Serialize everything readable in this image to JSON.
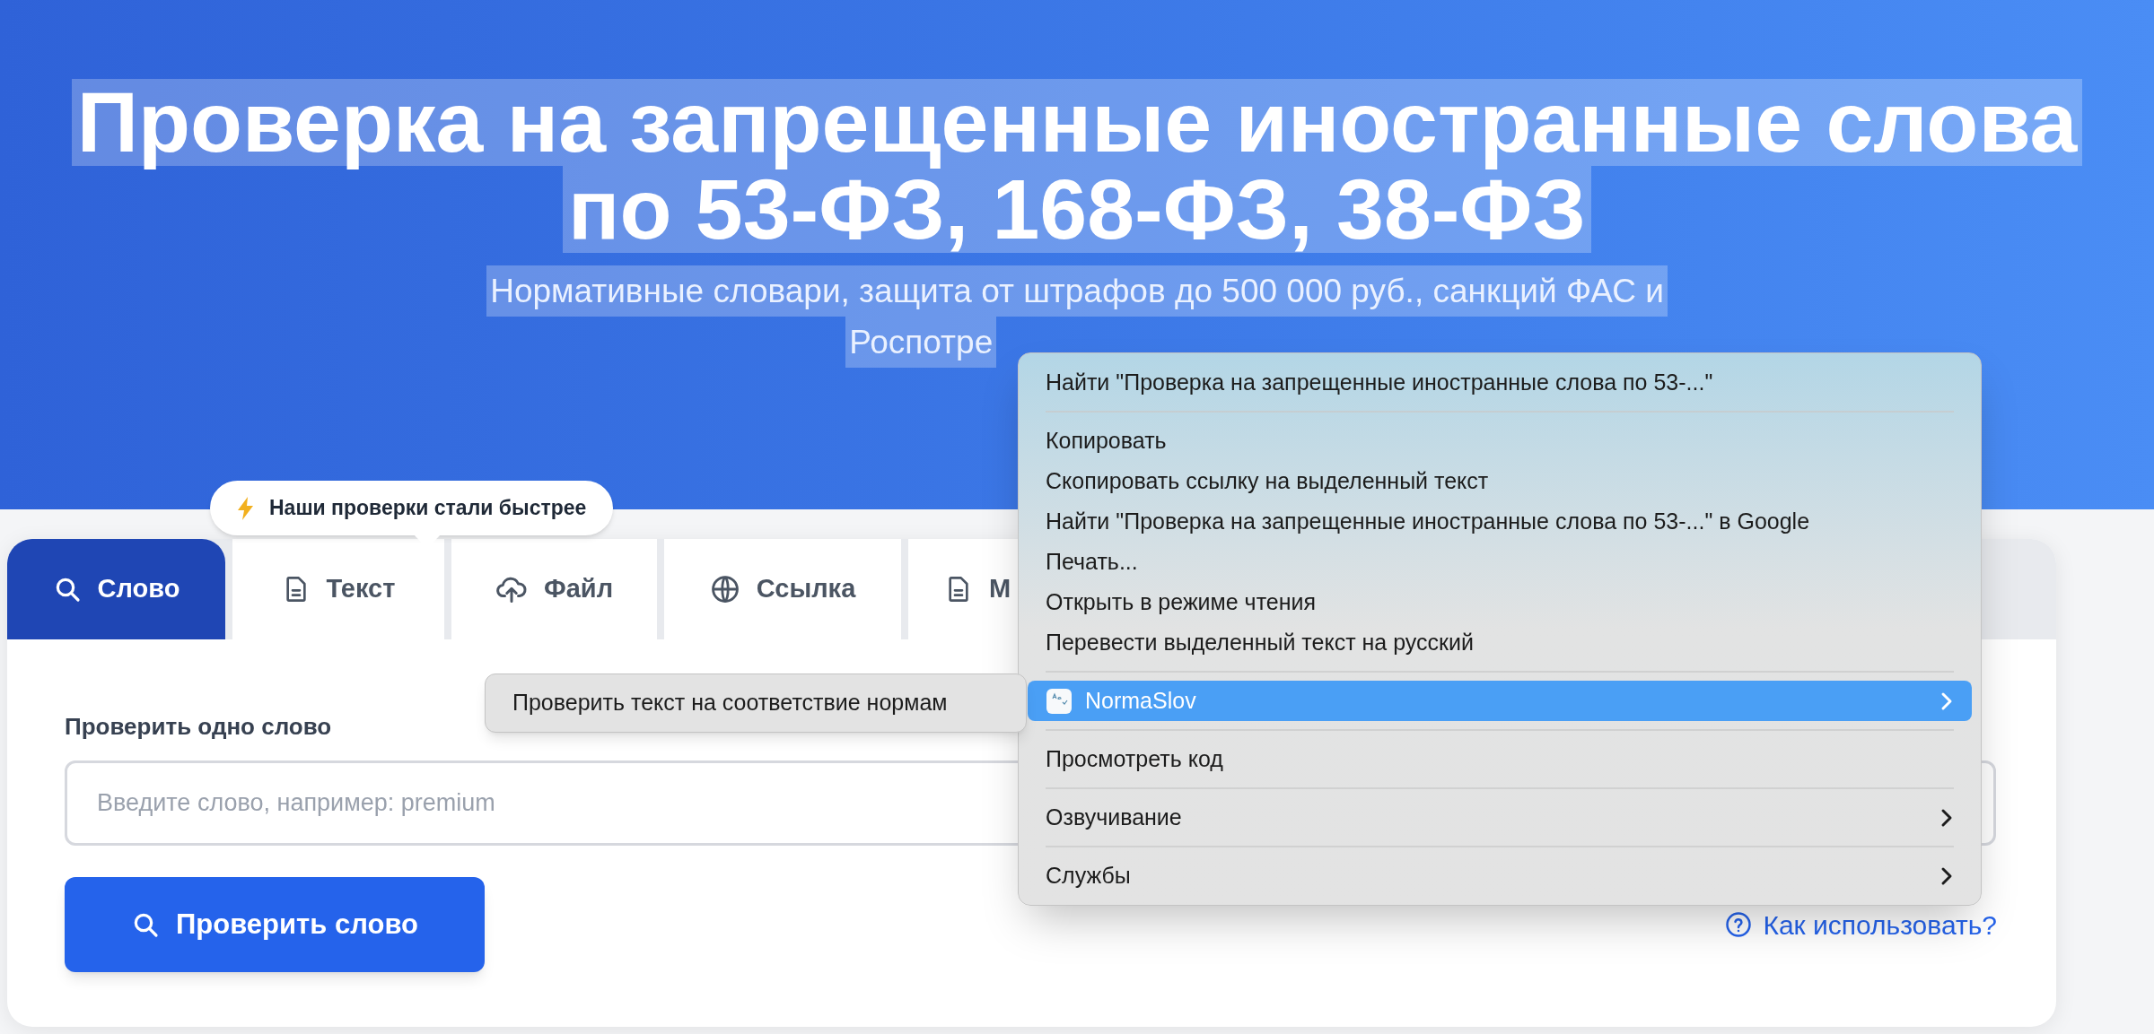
{
  "hero": {
    "selected": true,
    "title_lines": [
      "Проверка на запрещенные иностранные слова",
      "по 53-ФЗ, 168-ФЗ, 38-ФЗ"
    ],
    "subtitle_lines": [
      "Нормативные словари, защита от штрафов до 500 000 руб., санкций ФАС и",
      "Роспотре"
    ]
  },
  "tooltip": {
    "text": "Наши проверки стали быстрее"
  },
  "tabs": [
    {
      "label": "Слово",
      "kind": "search",
      "selected": true
    },
    {
      "label": "Текст",
      "kind": "document",
      "selected": false
    },
    {
      "label": "Файл",
      "kind": "upload",
      "selected": false
    },
    {
      "label": "Ссылка",
      "kind": "globe",
      "selected": false
    },
    {
      "label": "М",
      "kind": "document",
      "selected": false
    }
  ],
  "form": {
    "label": "Проверить одно слово",
    "placeholder": "Введите слово, например: premium",
    "button": "Проверить слово",
    "help_link": "Как использовать?"
  },
  "context_menu": {
    "items": [
      {
        "kind": "item",
        "label": "Найти \"Проверка на запрещенные иностранные слова по 53-...\"",
        "has_submenu": false,
        "selected": false
      },
      {
        "kind": "separator"
      },
      {
        "kind": "item",
        "label": "Копировать",
        "has_submenu": false,
        "selected": false
      },
      {
        "kind": "item",
        "label": "Скопировать ссылку на выделенный текст",
        "has_submenu": false,
        "selected": false
      },
      {
        "kind": "item",
        "label": "Найти \"Проверка на запрещенные иностранные слова по 53-...\" в Google",
        "has_submenu": false,
        "selected": false
      },
      {
        "kind": "item",
        "label": "Печать...",
        "has_submenu": false,
        "selected": false
      },
      {
        "kind": "item",
        "label": "Открыть в режиме чтения",
        "has_submenu": false,
        "selected": false
      },
      {
        "kind": "item",
        "label": "Перевести выделенный текст на русский",
        "has_submenu": false,
        "selected": false
      },
      {
        "kind": "separator"
      },
      {
        "kind": "app_item",
        "label": "NormaSlov",
        "has_submenu": true,
        "selected": true
      },
      {
        "kind": "separator"
      },
      {
        "kind": "item",
        "label": "Просмотреть код",
        "has_submenu": false,
        "selected": false
      },
      {
        "kind": "separator"
      },
      {
        "kind": "item",
        "label": "Озвучивание",
        "has_submenu": true,
        "selected": false
      },
      {
        "kind": "separator"
      },
      {
        "kind": "item",
        "label": "Службы",
        "has_submenu": true,
        "selected": false
      }
    ]
  },
  "submenu": {
    "items": [
      {
        "label": "Проверить текст на соответствие нормам"
      }
    ]
  }
}
